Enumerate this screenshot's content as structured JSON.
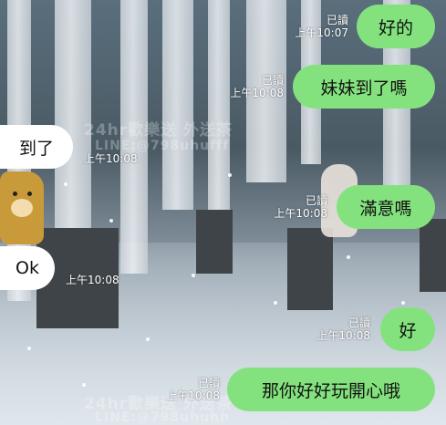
{
  "messages": [
    {
      "direction": "outgoing",
      "text": "好的",
      "read": "已讀",
      "time": "上午10:07"
    },
    {
      "direction": "outgoing",
      "text": "妹妹到了嗎",
      "read": "已讀",
      "time": "上午10:08"
    },
    {
      "direction": "incoming",
      "text": "到了",
      "time": "上午10:08"
    },
    {
      "direction": "outgoing",
      "text": "滿意嗎",
      "read": "已讀",
      "time": "上午10:08"
    },
    {
      "direction": "incoming",
      "text": "Ok",
      "time": "上午10:08"
    },
    {
      "direction": "outgoing",
      "text": "好",
      "read": "已讀",
      "time": "上午10:08"
    },
    {
      "direction": "outgoing",
      "text": "那你好好玩開心哦",
      "read": "已讀",
      "time": "上午10:08"
    }
  ],
  "watermarks": [
    "24hr歡樂送 外送茶",
    "LINE:@798uhufff",
    "24hr歡樂送 外送茶",
    "LINE:@798uhuhh"
  ],
  "colors": {
    "outgoing_bubble": "#84e27e",
    "incoming_bubble": "#ffffff",
    "meta_text": "#ffffff"
  }
}
